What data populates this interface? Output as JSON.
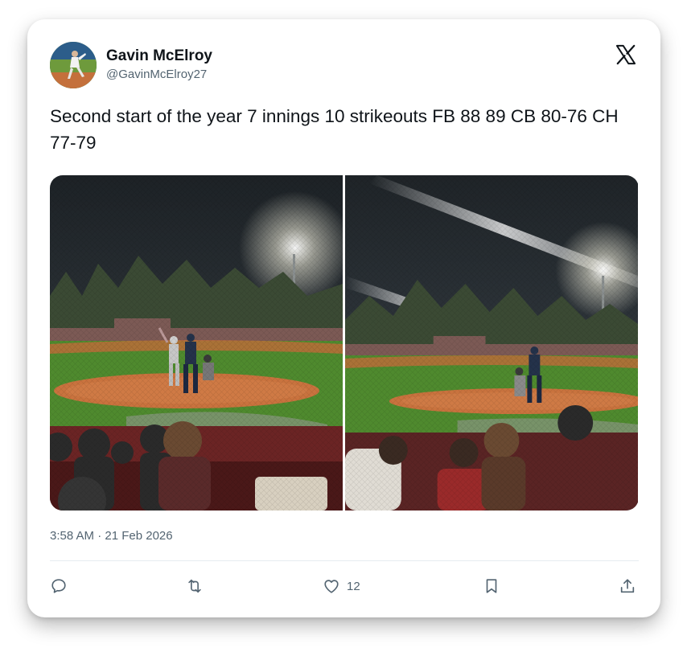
{
  "tweet": {
    "author_name": "Gavin McElroy",
    "author_handle": "@GavinMcElroy27",
    "text": "Second start of the year 7 innings 10 strikeouts FB 88 89 CB 80-76 CH 77-79",
    "timestamp": "3:58 AM · 21 Feb 2026",
    "platform_icon": "x-logo-icon"
  },
  "media": [
    {
      "icon": "baseball-night-game-photo"
    },
    {
      "icon": "baseball-night-game-photo"
    }
  ],
  "actions": {
    "reply_icon": "reply-icon",
    "repost_icon": "repost-icon",
    "like_icon": "heart-icon",
    "like_count": "12",
    "bookmark_icon": "bookmark-icon",
    "share_icon": "share-icon"
  },
  "colors": {
    "text_primary": "#0f1419",
    "text_secondary": "#536471",
    "divider": "#e6ecf0"
  }
}
